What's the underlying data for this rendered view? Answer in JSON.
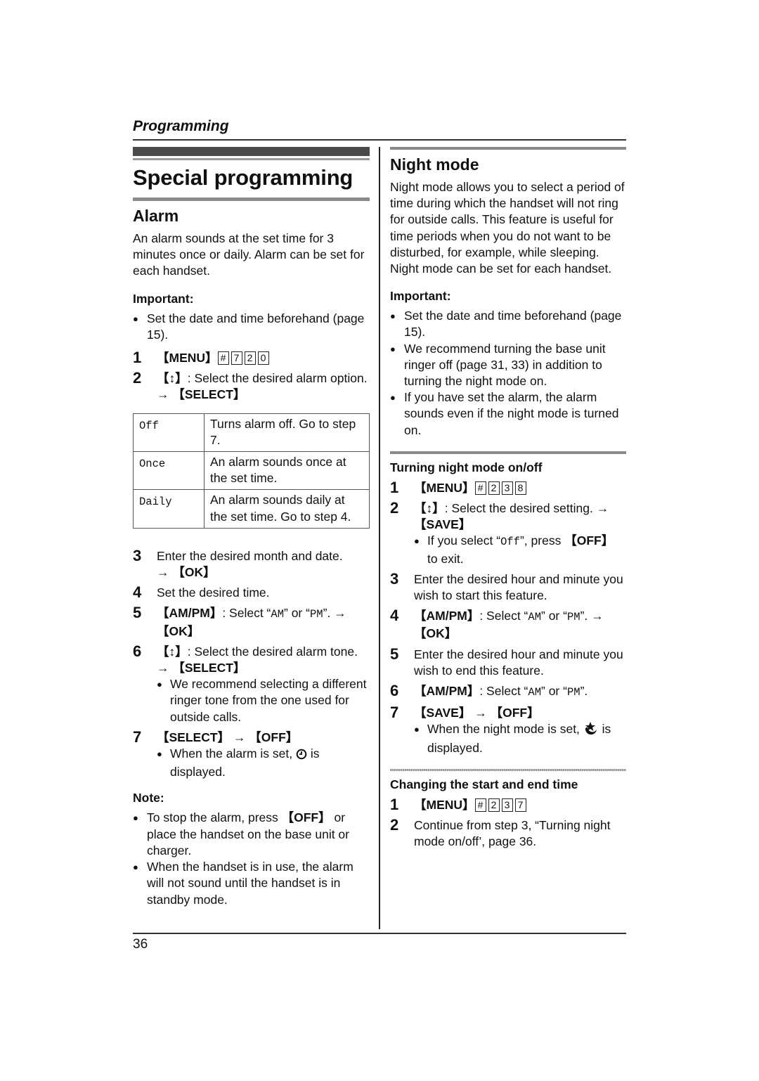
{
  "header": {
    "section": "Programming"
  },
  "left": {
    "title": "Special programming",
    "alarm": {
      "heading": "Alarm",
      "intro": "An alarm sounds at the set time for 3 minutes once or daily. Alarm can be set for each handset.",
      "important_label": "Important:",
      "important": [
        "Set the date and time beforehand (page 15)."
      ],
      "step1": {
        "num": "1",
        "key": "【MENU】",
        "codes": [
          "#",
          "7",
          "2",
          "0"
        ]
      },
      "step2": {
        "num": "2",
        "key": "【↕】",
        "text": ": Select the desired alarm option.",
        "arrow": "→",
        "action": "【SELECT】"
      },
      "options": [
        {
          "key": "Off",
          "desc": "Turns alarm off. Go to step 7."
        },
        {
          "key": "Once",
          "desc": "An alarm sounds once at the set time."
        },
        {
          "key": "Daily",
          "desc": "An alarm sounds daily at the set time. Go to step 4."
        }
      ],
      "step3": {
        "num": "3",
        "text": "Enter the desired month and date.",
        "arrow": "→",
        "action": "【OK】"
      },
      "step4": {
        "num": "4",
        "text": "Set the desired time."
      },
      "step5": {
        "num": "5",
        "key": "【AM/PM】",
        "text_a": ": Select “",
        "am": "AM",
        "text_b": "” or “",
        "pm": "PM",
        "text_c": "”. →",
        "action": "【OK】"
      },
      "step6": {
        "num": "6",
        "key": "【↕】",
        "text": ": Select the desired alarm tone.",
        "arrow": "→",
        "action": "【SELECT】",
        "note": "We recommend selecting a different ringer tone from the one used for outside calls."
      },
      "step7": {
        "num": "7",
        "key_a": "【SELECT】",
        "arrow": "→",
        "key_b": "【OFF】",
        "note_a": "When the alarm is set, ",
        "note_b": " is displayed."
      },
      "note_label": "Note:",
      "notes": [
        {
          "a": "To stop the alarm, press ",
          "key": "【OFF】",
          "b": " or place the handset on the base unit or charger."
        },
        {
          "a": "When the handset is in use, the alarm will not sound until the handset is in standby mode.",
          "key": "",
          "b": ""
        }
      ]
    }
  },
  "right": {
    "heading": "Night mode",
    "intro": "Night mode allows you to select a period of time during which the handset will not ring for outside calls. This feature is useful for time periods when you do not want to be disturbed, for example, while sleeping. Night mode can be set for each handset.",
    "important_label": "Important:",
    "important": [
      "Set the date and time beforehand (page 15).",
      "We recommend turning the base unit ringer off (page 31, 33) in addition to turning the night mode on.",
      "If you have set the alarm, the alarm sounds even if the night mode is turned on."
    ],
    "onoff": {
      "heading": "Turning night mode on/off",
      "step1": {
        "num": "1",
        "key": "【MENU】",
        "codes": [
          "#",
          "2",
          "3",
          "8"
        ]
      },
      "step2": {
        "num": "2",
        "key": "【↕】",
        "text": ": Select the desired setting. →",
        "action": "【SAVE】",
        "note_a": "If you select “",
        "note_mono": "Off",
        "note_b": "”, press ",
        "note_key": "【OFF】",
        "note_c": " to exit."
      },
      "step3": {
        "num": "3",
        "text": "Enter the desired hour and minute you wish to start this feature."
      },
      "step4": {
        "num": "4",
        "key": "【AM/PM】",
        "text_a": ": Select “",
        "am": "AM",
        "text_b": "” or “",
        "pm": "PM",
        "text_c": "”. →",
        "action": "【OK】"
      },
      "step5": {
        "num": "5",
        "text": "Enter the desired hour and minute you wish to end this feature."
      },
      "step6": {
        "num": "6",
        "key": "【AM/PM】",
        "text_a": ": Select “",
        "am": "AM",
        "text_b": "” or “",
        "pm": "PM",
        "text_c": "”."
      },
      "step7": {
        "num": "7",
        "key_a": "【SAVE】",
        "arrow": "→",
        "key_b": "【OFF】",
        "note_a": "When the night mode is set, ",
        "note_b": " is displayed."
      }
    },
    "change": {
      "heading": "Changing the start and end time",
      "step1": {
        "num": "1",
        "key": "【MENU】",
        "codes": [
          "#",
          "2",
          "3",
          "7"
        ]
      },
      "step2": {
        "num": "2",
        "text": "Continue from step 3, “Turning night mode on/off’, page 36."
      }
    }
  },
  "footer": {
    "page_number": "36"
  },
  "icons": {
    "alarm": "alarm-clock-icon",
    "night": "night-mode-moon-star-icon",
    "updown": "up-down-arrow-icon"
  }
}
